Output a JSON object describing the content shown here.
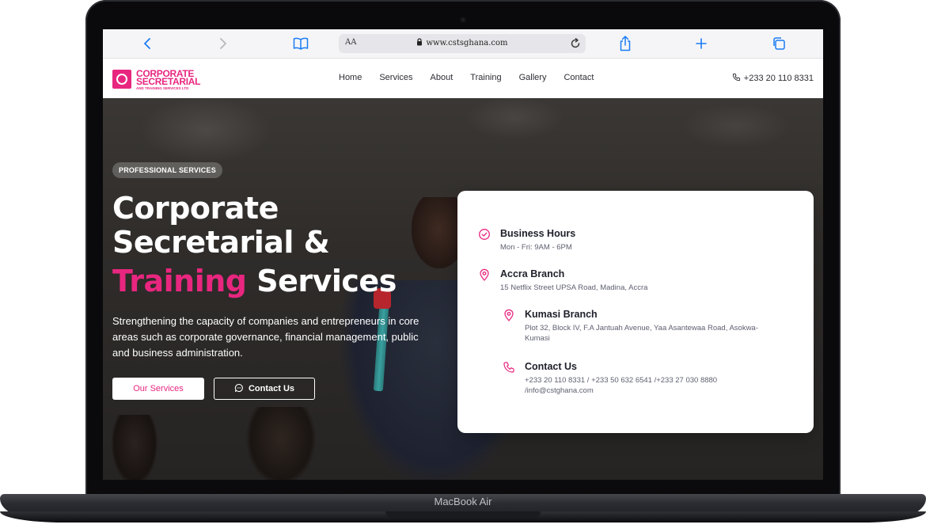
{
  "device": {
    "model_label": "MacBook Air"
  },
  "browser": {
    "address": {
      "aa_label": "AA",
      "url": "www.cstsghana.com"
    },
    "icons": [
      "back-chevron-icon",
      "forward-chevron-icon",
      "bookmarks-book-icon",
      "lock-icon",
      "reload-icon",
      "share-icon",
      "new-tab-plus-icon",
      "tabs-overview-icon"
    ]
  },
  "site": {
    "logo": {
      "line1": "CORPORATE",
      "line2": "SECRETARIAL",
      "line3": "AND TRAINING SERVICES LTD"
    },
    "nav": {
      "links": [
        "Home",
        "Services",
        "About",
        "Training",
        "Gallery",
        "Contact"
      ],
      "phone": "+233 20 110 8331"
    },
    "hero": {
      "badge": "PROFESSIONAL SERVICES",
      "title_line1": "Corporate",
      "title_line2": "Secretarial &",
      "title_highlight": "Training",
      "title_rest": "Services",
      "lede": "Strengthening the capacity of companies and entrepreneurs in core areas such as corporate governance, financial management, public and business administration.",
      "primary_cta": "Our Services",
      "secondary_cta": "Contact Us"
    },
    "info_card": {
      "hours_title": "Business Hours",
      "hours_detail": "Mon - Fri: 9AM - 6PM",
      "accra_title": "Accra Branch",
      "accra_detail": "15 Netflix Street UPSA Road, Madina, Accra",
      "kumasi_title": "Kumasi Branch",
      "kumasi_detail": "Plot 32, Block IV, F.A Jantuah Avenue, Yaa Asantewaa Road, Asokwa-Kumasi",
      "contact_title": "Contact Us",
      "contact_detail": "+233 20 110 8331 / +233 50 632 6541 /+233 27 030 8880 /info@cstghana.com"
    }
  },
  "colors": {
    "brand_pink": "#e8267f",
    "ios_blue": "#1a7cf5"
  }
}
